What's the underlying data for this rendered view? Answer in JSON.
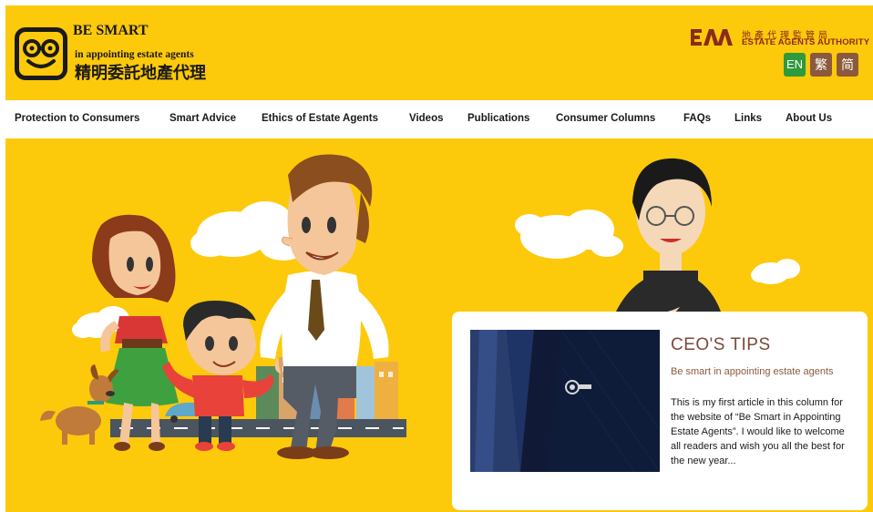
{
  "header": {
    "logo_title": "BE SMART",
    "logo_subtitle": "in appointing estate agents",
    "logo_chinese": "精明委託地產代理",
    "eaa_chinese": "地產代理監管局",
    "eaa_english": "ESTATE AGENTS AUTHORITY",
    "eaa_mark": "EAA",
    "colors": {
      "brand_yellow": "#fdc90b",
      "eaa_red": "#8a2b1b"
    }
  },
  "languages": [
    {
      "label": "EN",
      "color": "#2d9a3c"
    },
    {
      "label": "繁",
      "color": "#8b5a3c"
    },
    {
      "label": "简",
      "color": "#8b5a3c"
    }
  ],
  "nav": {
    "items": [
      {
        "label": "Protection to Consumers"
      },
      {
        "label": "Smart Advice"
      },
      {
        "label": "Ethics of Estate Agents"
      },
      {
        "label": "Videos"
      },
      {
        "label": "Publications"
      },
      {
        "label": "Consumer Columns"
      },
      {
        "label": "FAQs"
      },
      {
        "label": "Links"
      },
      {
        "label": "About Us"
      }
    ]
  },
  "tips": {
    "title": "CEO'S TIPS",
    "subtitle": "Be smart in appointing estate agents",
    "body": "This is my first article in this column for the website of “Be Smart in Appointing Estate Agents”. I would like to welcome all readers and wish you all the best for the new year..."
  }
}
